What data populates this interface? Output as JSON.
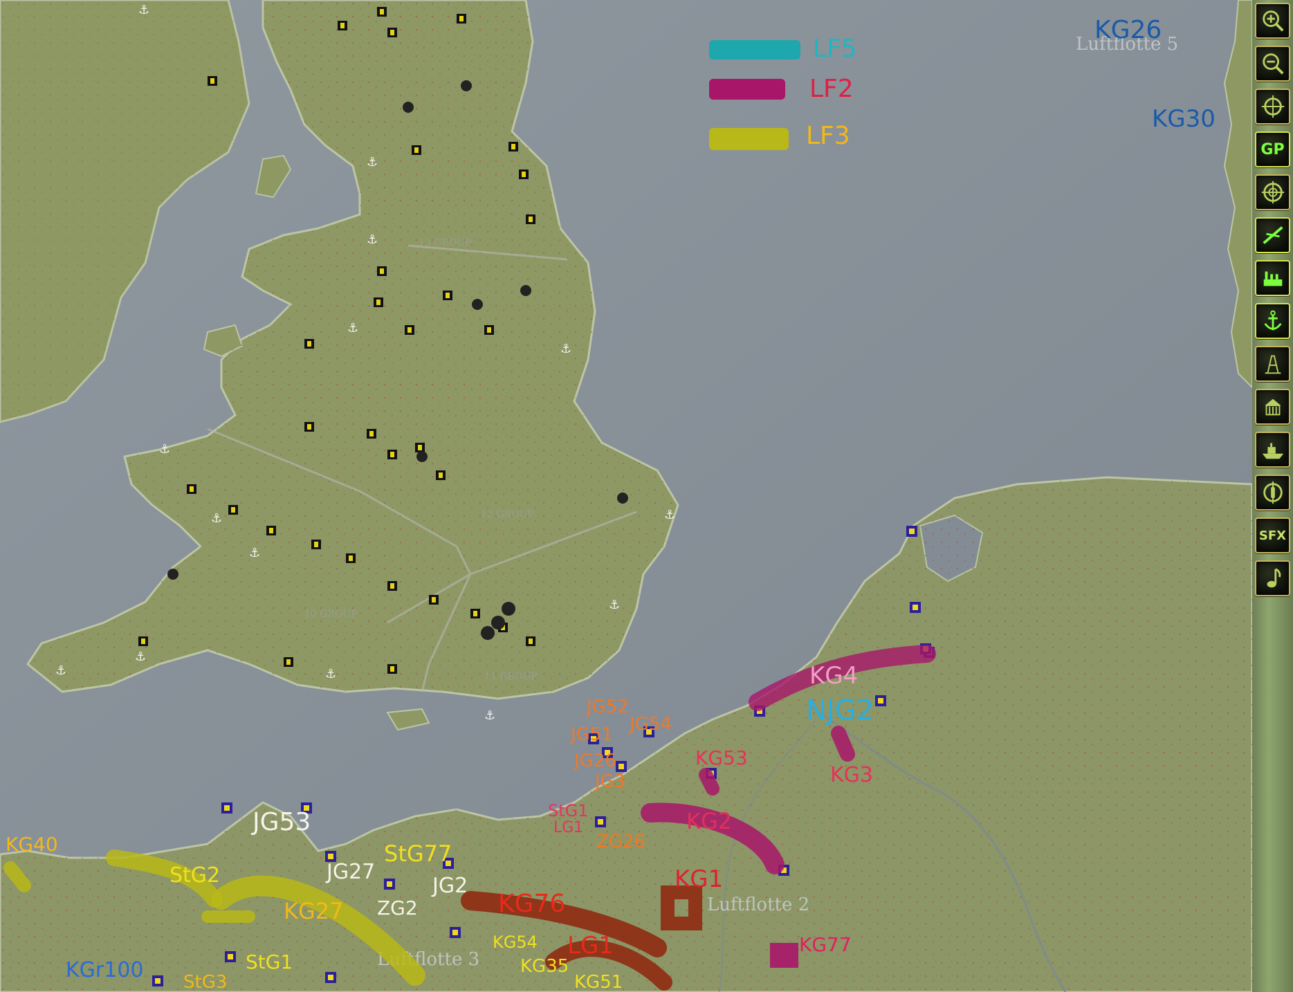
{
  "map": {
    "region_labels": {
      "lf5": "Luftflotte 5",
      "lf2": "Luftflotte 2",
      "lf3": "Luftflotte 3"
    },
    "group_labels": {
      "g13": "13 GROUP",
      "g12": "12 GROUP",
      "g10": "10 GROUP",
      "g11": "11 GROUP"
    }
  },
  "legend": {
    "items": [
      {
        "label": "LF5",
        "color": "#1ea8ae"
      },
      {
        "label": "LF2",
        "color": "#a8166a"
      },
      {
        "label": "LF3",
        "color": "#b8b818"
      }
    ]
  },
  "annotations": {
    "kg26": "KG26",
    "kg30": "KG30",
    "kg4": "KG4",
    "njg2": "NJG2",
    "jg52": "JG52",
    "jg51": "JG51",
    "jg54": "JG54",
    "jg26": "JG26",
    "jg3": "JG3",
    "kg53": "KG53",
    "kg3": "KG3",
    "stg1_lg1": "StG1",
    "lg1": "LG1",
    "zg26": "ZG26",
    "kg2": "KG2",
    "kg1": "KG1",
    "kg77": "KG77",
    "kg76": "KG76",
    "lg1b": "LG1",
    "kg54": "KG54",
    "kg35": "KG35",
    "kg51": "KG51",
    "jg53": "JG53",
    "jg27": "JG27",
    "stg77": "StG77",
    "jg2": "JG2",
    "zg2": "ZG2",
    "kg27": "KG27",
    "stg2": "StG2",
    "kg40": "KG40",
    "stg1": "StG1",
    "stg3": "StG3",
    "kgr100": "KGr100"
  },
  "toolbar": {
    "buttons": [
      {
        "name": "zoom-in",
        "icon": "zoom-in-icon"
      },
      {
        "name": "zoom-out",
        "icon": "zoom-out-icon"
      },
      {
        "name": "center",
        "icon": "crosshair-icon"
      },
      {
        "name": "gp",
        "label": "GP"
      },
      {
        "name": "radar",
        "icon": "radar-target-icon"
      },
      {
        "name": "airfields",
        "icon": "airfield-icon"
      },
      {
        "name": "factories",
        "icon": "factory-icon"
      },
      {
        "name": "ports",
        "icon": "anchor-icon"
      },
      {
        "name": "towers",
        "icon": "tower-icon"
      },
      {
        "name": "cities",
        "icon": "building-icon"
      },
      {
        "name": "ships",
        "icon": "ship-icon"
      },
      {
        "name": "observer",
        "icon": "observer-icon"
      },
      {
        "name": "sfx",
        "label": "SFX"
      },
      {
        "name": "music",
        "icon": "music-note-icon"
      }
    ]
  }
}
